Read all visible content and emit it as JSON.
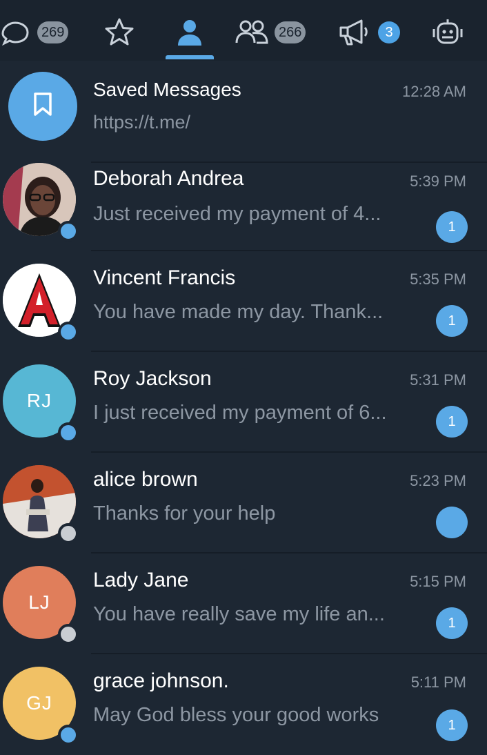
{
  "tabs": {
    "all": {
      "icon": "chat-bubble-icon",
      "count": "269"
    },
    "favorites": {
      "icon": "star-icon"
    },
    "personal": {
      "icon": "person-icon",
      "active": true
    },
    "groups": {
      "icon": "group-icon",
      "count": "266"
    },
    "channels": {
      "icon": "megaphone-icon",
      "count": "3"
    },
    "bots": {
      "icon": "bot-icon"
    }
  },
  "colors": {
    "background": "#1d2733",
    "tabbar": "#1a232e",
    "accent": "#5aa9e6",
    "online_dot": "#5aa9e6",
    "offline_dot": "#c9cdd2"
  },
  "chats": [
    {
      "name": "Saved Messages",
      "preview": "https://t.me/",
      "time": "12:28 AM",
      "avatar": "bookmark-icon",
      "avatar_color": "#5aa9e6",
      "unread": ""
    },
    {
      "name": "Deborah Andrea",
      "preview": "Just received my payment of 4...",
      "time": "5:39 PM",
      "avatar": "photo",
      "avatar_color": "#7a5a55",
      "unread": "1",
      "online": true
    },
    {
      "name": "Vincent Francis",
      "preview": "You have made my day. Thank...",
      "time": "5:35 PM",
      "avatar": "letter-a-logo",
      "avatar_color": "#ffffff",
      "unread": "1",
      "online": true
    },
    {
      "name": "Roy Jackson",
      "initials": "RJ",
      "preview": "I just received my payment of 6...",
      "time": "5:31 PM",
      "avatar_color": "#57b7d4",
      "unread": "1",
      "online": true
    },
    {
      "name": "alice brown",
      "preview": "Thanks for your help",
      "time": "5:23 PM",
      "avatar": "photo",
      "avatar_color": "#b5492a",
      "unread": "",
      "online": false
    },
    {
      "name": "Lady Jane",
      "initials": "LJ",
      "preview": "You have really save my life an...",
      "time": "5:15 PM",
      "avatar_color": "#e07e5b",
      "unread": "1",
      "online": false
    },
    {
      "name": "grace johnson.",
      "initials": "GJ",
      "preview": "May God bless your good works",
      "time": "5:11 PM",
      "avatar_color": "#f1c165",
      "unread": "1",
      "online": true
    }
  ]
}
